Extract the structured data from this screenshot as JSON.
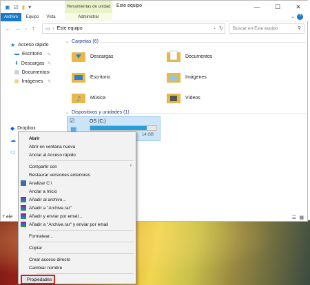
{
  "window": {
    "title": "Este equipo",
    "context_tab_header": "Herramientas de unidad",
    "ribbon_tabs": [
      "Archivo",
      "Equipo",
      "Vista",
      "Administrar"
    ],
    "controls": {
      "minimize": "—",
      "maximize": "☐",
      "close": "✕"
    },
    "help": "?"
  },
  "address": {
    "path": "Este equipo",
    "search_placeholder": "Buscar en Este equipo"
  },
  "navpane": {
    "quick_access": "Acceso rápido",
    "items": [
      "Escritorio",
      "Descargas",
      "Documentos",
      "Imágenes"
    ],
    "dropbox": "Dropbox"
  },
  "content": {
    "folders_header": "Carpetas (6)",
    "folders": [
      "Descargas",
      "Documentos",
      "Escritorio",
      "Imágenes",
      "Música",
      "Vídeos"
    ],
    "devices_header": "Dispositivos y unidades (1)",
    "drive_name": "OS (C:)",
    "drive_free": "14 GB",
    "drive_used_fraction": 0.85
  },
  "status": {
    "items_count": "7 ele"
  },
  "context_menu": {
    "groups": [
      [
        {
          "label": "Abrir",
          "bold": true
        },
        {
          "label": "Abrir en ventana nueva"
        },
        {
          "label": "Anclar al Acceso rápido"
        }
      ],
      [
        {
          "label": "Compartir con",
          "submenu": true
        },
        {
          "label": "Restaurar versiones anteriores"
        },
        {
          "label": "Analizar C:\\",
          "icon": "defender-icon"
        },
        {
          "label": "Anclar a Inicio"
        },
        {
          "label": "Añadir al archivo...",
          "icon": "winrar-icon"
        },
        {
          "label": "Añadir a \"Archive.rar\"",
          "icon": "winrar-icon"
        },
        {
          "label": "Añadir y enviar por email...",
          "icon": "winrar-icon"
        },
        {
          "label": "Añadir a \"Archive.rar\" y enviar por email",
          "icon": "winrar-icon"
        }
      ],
      [
        {
          "label": "Formatear..."
        }
      ],
      [
        {
          "label": "Copiar"
        }
      ],
      [
        {
          "label": "Crear acceso directo"
        },
        {
          "label": "Cambiar nombre"
        }
      ],
      [
        {
          "label": "Propiedades",
          "highlighted": true
        }
      ]
    ]
  },
  "colors": {
    "accent": "#1979ca",
    "highlight_border": "#d0202b",
    "folder": "#e8b84a",
    "header_text": "#1e3a8a"
  }
}
